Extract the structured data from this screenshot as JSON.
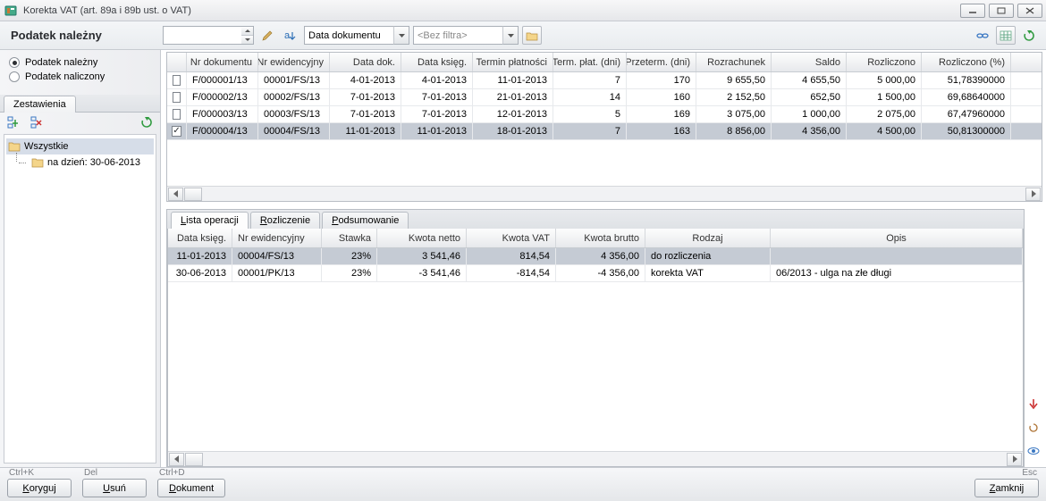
{
  "window": {
    "title": "Korekta VAT (art. 89a i 89b ust. o VAT)"
  },
  "section": {
    "label": "Podatek należny"
  },
  "radios": {
    "nalezny": "Podatek należny",
    "naliczony": "Podatek naliczony"
  },
  "toolbar": {
    "date_combo_label": "Data dokumentu",
    "filter_placeholder": "<Bez filtra>"
  },
  "tree": {
    "tab": "Zestawienia",
    "root": "Wszystkie",
    "child": "na dzień: 30-06-2013"
  },
  "mainGrid": {
    "headers": {
      "chk": "",
      "nrdok": "Nr dokumentu",
      "nrewid": "Nr ewidencyjny",
      "datadok": "Data dok.",
      "dataksieg": "Data księg.",
      "termin": "Termin płatności",
      "termdni": "Term. płat. (dni)",
      "przeterm": "Przeterm. (dni)",
      "rozrach": "Rozrachunek",
      "saldo": "Saldo",
      "rozlicz": "Rozliczono",
      "rozliczpct": "Rozliczono (%)"
    },
    "rows": [
      {
        "chk": false,
        "nrdok": "F/000001/13",
        "nrewid": "00001/FS/13",
        "ddok": "4-01-2013",
        "dksg": "4-01-2013",
        "term": "11-01-2013",
        "dni": "7",
        "przet": "170",
        "rozr": "9 655,50",
        "saldo": "4 655,50",
        "rozl": "5 000,00",
        "pct": "51,78390000"
      },
      {
        "chk": false,
        "nrdok": "F/000002/13",
        "nrewid": "00002/FS/13",
        "ddok": "7-01-2013",
        "dksg": "7-01-2013",
        "term": "21-01-2013",
        "dni": "14",
        "przet": "160",
        "rozr": "2 152,50",
        "saldo": "652,50",
        "rozl": "1 500,00",
        "pct": "69,68640000"
      },
      {
        "chk": false,
        "nrdok": "F/000003/13",
        "nrewid": "00003/FS/13",
        "ddok": "7-01-2013",
        "dksg": "7-01-2013",
        "term": "12-01-2013",
        "dni": "5",
        "przet": "169",
        "rozr": "3 075,00",
        "saldo": "1 000,00",
        "rozl": "2 075,00",
        "pct": "67,47960000"
      },
      {
        "chk": true,
        "nrdok": "F/000004/13",
        "nrewid": "00004/FS/13",
        "ddok": "11-01-2013",
        "dksg": "11-01-2013",
        "term": "18-01-2013",
        "dni": "7",
        "przet": "163",
        "rozr": "8 856,00",
        "saldo": "4 356,00",
        "rozl": "4 500,00",
        "pct": "50,81300000"
      }
    ]
  },
  "lowerTabs": {
    "t1": "Lista operacji",
    "t2": "Rozliczenie",
    "t3": "Podsumowanie"
  },
  "lowerGrid": {
    "headers": {
      "dksg": "Data księg.",
      "ewid": "Nr ewidencyjny",
      "stawka": "Stawka",
      "netto": "Kwota netto",
      "vat": "Kwota VAT",
      "brutto": "Kwota brutto",
      "rodzaj": "Rodzaj",
      "opis": "Opis"
    },
    "rows": [
      {
        "dksg": "11-01-2013",
        "ewid": "00004/FS/13",
        "staw": "23%",
        "netto": "3 541,46",
        "vat": "814,54",
        "brutto": "4 356,00",
        "rodz": "do rozliczenia",
        "opis": ""
      },
      {
        "dksg": "30-06-2013",
        "ewid": "00001/PK/13",
        "staw": "23%",
        "netto": "-3 541,46",
        "vat": "-814,54",
        "brutto": "-4 356,00",
        "rodz": "korekta VAT",
        "opis": "06/2013 - ulga na złe długi"
      }
    ]
  },
  "buttons": {
    "koryguj_hint": "Ctrl+K",
    "koryguj": "Koryguj",
    "usun_hint": "Del",
    "usun": "Usuń",
    "dokument_hint": "Ctrl+D",
    "dokument": "Dokument",
    "zamknij_hint": "Esc",
    "zamknij": "Zamknij"
  }
}
